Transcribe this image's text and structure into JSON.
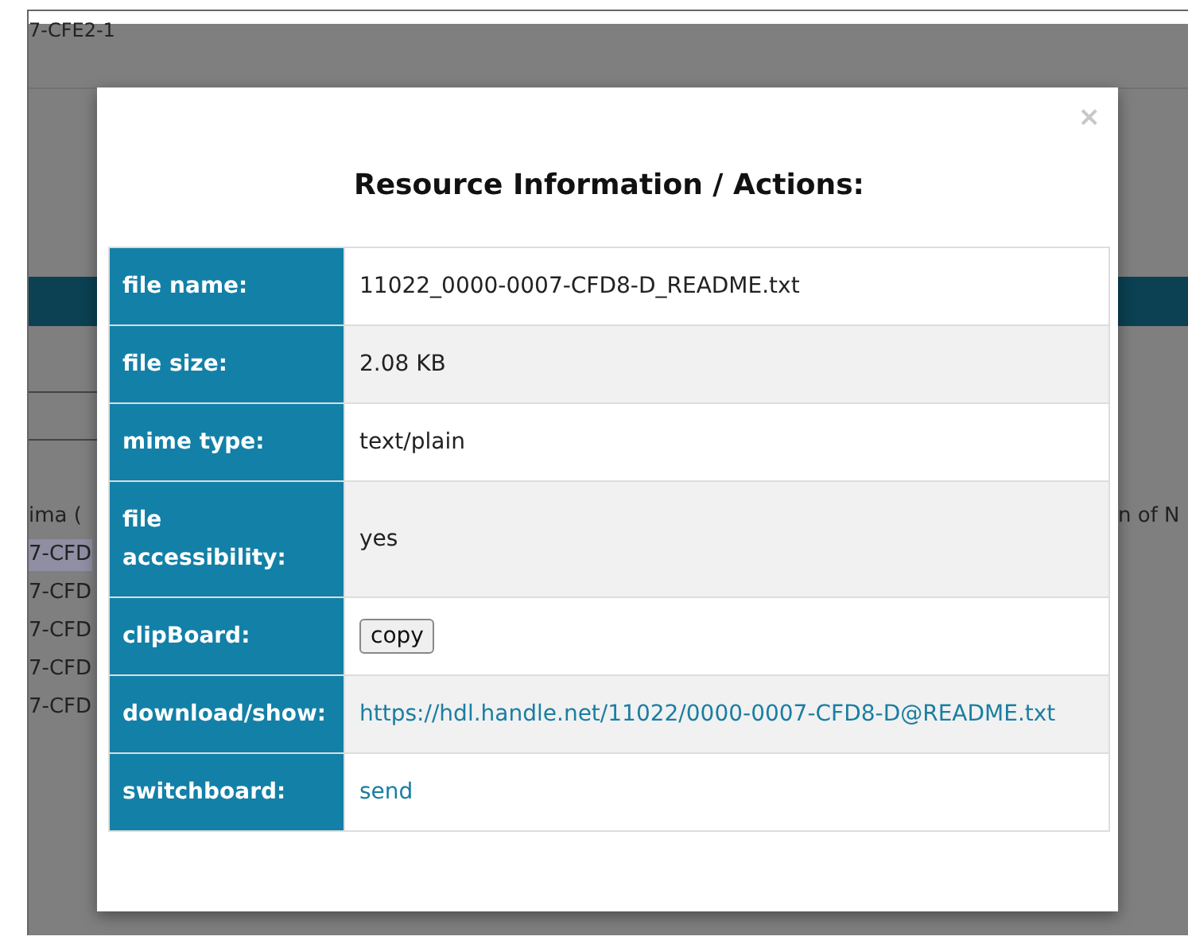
{
  "background": {
    "header_text": "7-CFE2-1",
    "left_text": "ima (",
    "right_text": "n of N",
    "list": [
      {
        "label": "7-CFD",
        "selected": true
      },
      {
        "label": "7-CFD",
        "selected": false
      },
      {
        "label": "7-CFD",
        "selected": false
      },
      {
        "label": "7-CFD",
        "selected": false
      },
      {
        "label": "7-CFD",
        "selected": false
      }
    ]
  },
  "dialog": {
    "close": "×",
    "title": "Resource Information / Actions:",
    "rows": [
      {
        "label": "file name:",
        "kind": "text",
        "value": "11022_0000-0007-CFD8-D_README.txt"
      },
      {
        "label": "file size:",
        "kind": "text",
        "value": "2.08 KB"
      },
      {
        "label": "mime type:",
        "kind": "text",
        "value": "text/plain"
      },
      {
        "label": "file accessibility:",
        "kind": "text",
        "value": "yes"
      },
      {
        "label": "clipBoard:",
        "kind": "button",
        "value": "copy"
      },
      {
        "label": "download/show:",
        "kind": "link",
        "value": "https://hdl.handle.net/11022/0000-0007-CFD8-D@README.txt"
      },
      {
        "label": "switchboard:",
        "kind": "link",
        "value": "send"
      }
    ]
  }
}
